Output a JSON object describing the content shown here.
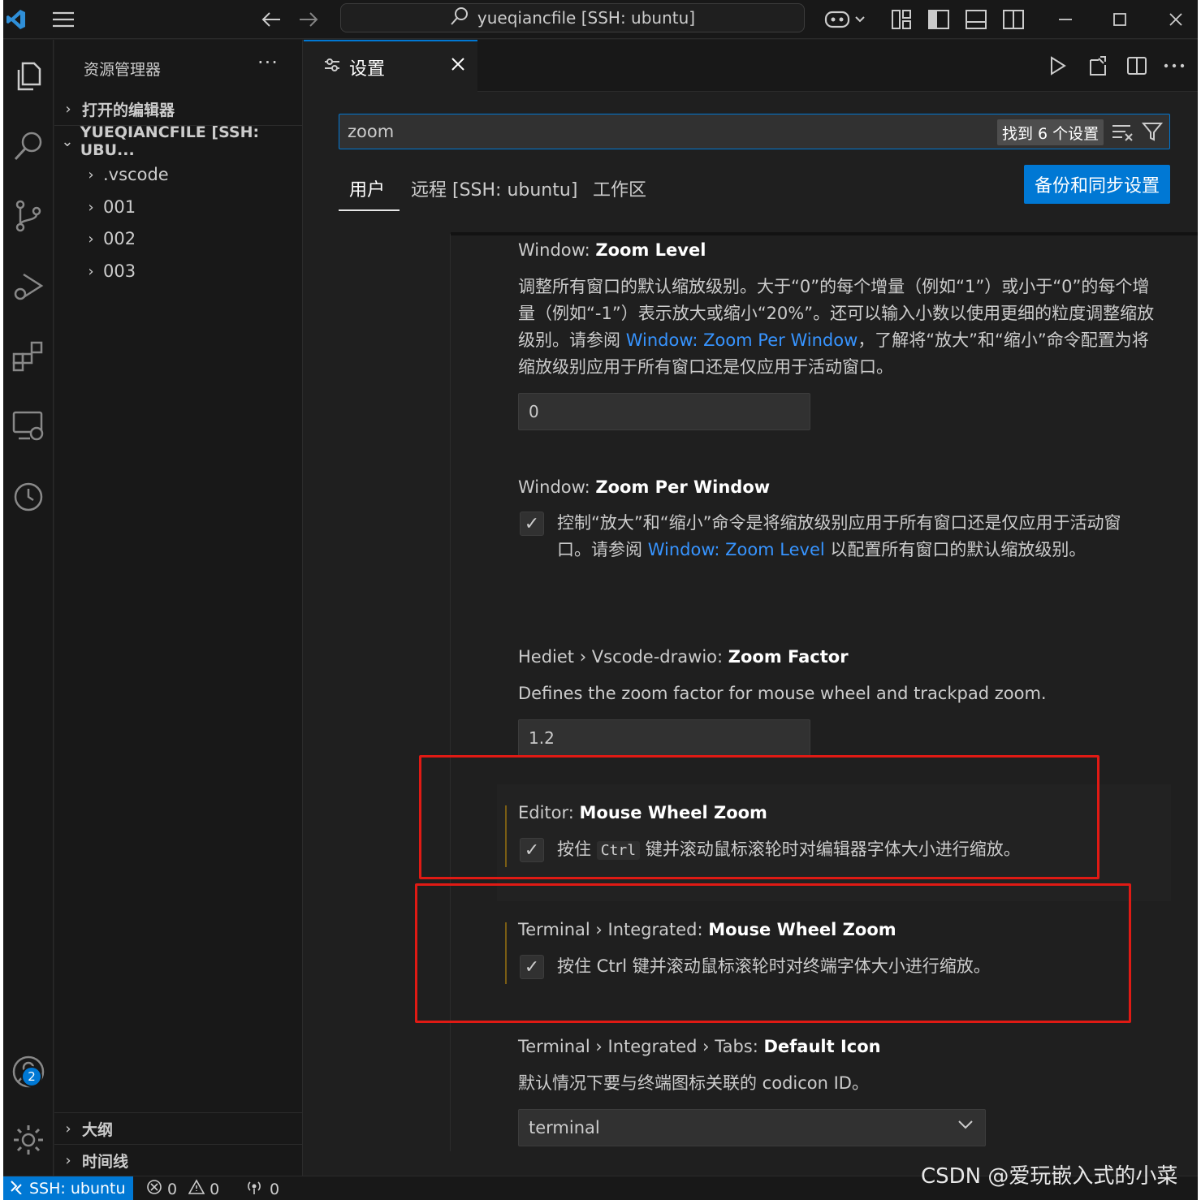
{
  "titlebar": {
    "title": "yueqiancfile [SSH: ubuntu]"
  },
  "activity_bar": {
    "accounts_badge": "2"
  },
  "explorer": {
    "title": "资源管理器",
    "more": "···",
    "open_editors": "打开的编辑器",
    "folder": "YUEQIANCFILE [SSH: UBU...",
    "items": [
      ".vscode",
      "001",
      "002",
      "003"
    ],
    "outline": "大纲",
    "timeline": "时间线"
  },
  "editor": {
    "tab_label": "设置",
    "search_value": "zoom",
    "result_count": "找到 6 个设置",
    "scope_tabs": [
      "用户",
      "远程 [SSH: ubuntu]",
      "工作区"
    ],
    "sync_button": "备份和同步设置"
  },
  "settings": [
    {
      "prefix": "Window: ",
      "name": "Zoom Level",
      "desc_1": "调整所有窗口的默认缩放级别。大于“0”的每个增量（例如“1”）或小于“0”的每个增量（例如“-1”）表示放大或缩小“20%”。还可以输入小数以使用更细的粒度调整缩放级别。请参阅 ",
      "link": "Window: Zoom Per Window",
      "desc_2": "，了解将“放大”和“缩小”命令配置为将缩放级别应用于所有窗口还是仅应用于活动窗口。",
      "value": "0"
    },
    {
      "prefix": "Window: ",
      "name": "Zoom Per Window",
      "desc_1": "控制“放大”和“缩小”命令是将缩放级别应用于所有窗口还是仅应用于活动窗口。请参阅 ",
      "link": "Window: Zoom Level",
      "desc_2": " 以配置所有窗口的默认缩放级别。"
    },
    {
      "prefix": "Hediet › Vscode-drawio: ",
      "name": "Zoom Factor",
      "desc": "Defines the zoom factor for mouse wheel and trackpad zoom.",
      "value": "1.2"
    },
    {
      "prefix": "Editor: ",
      "name": "Mouse Wheel Zoom",
      "desc_1": "按住 ",
      "key": "Ctrl",
      "desc_2": " 键并滚动鼠标滚轮时对编辑器字体大小进行缩放。"
    },
    {
      "prefix": "Terminal › Integrated: ",
      "name": "Mouse Wheel Zoom",
      "desc": "按住 Ctrl 键并滚动鼠标滚轮时对终端字体大小进行缩放。"
    },
    {
      "prefix": "Terminal › Integrated › Tabs: ",
      "name": "Default Icon",
      "desc": "默认情况下要与终端图标关联的 codicon ID。",
      "value": "terminal"
    }
  ],
  "status_bar": {
    "remote": "SSH: ubuntu",
    "errors": "0",
    "warnings": "0",
    "ports": "0"
  },
  "watermark": "CSDN @爱玩嵌入式的小菜"
}
